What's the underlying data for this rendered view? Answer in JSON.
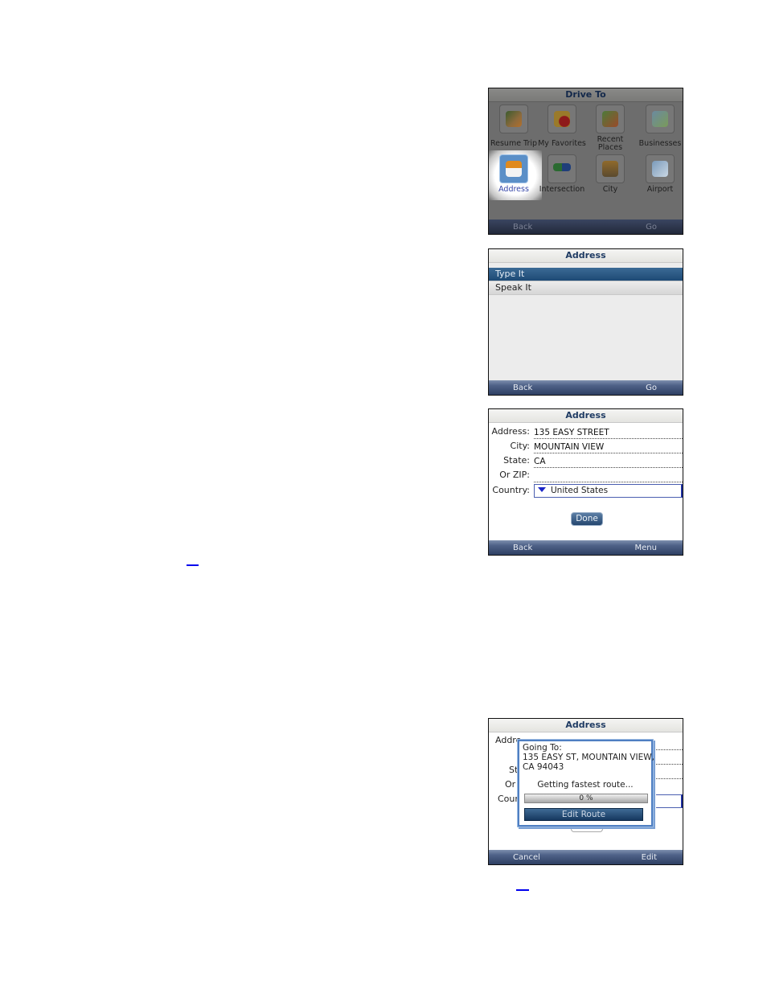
{
  "screens": {
    "drive_to": {
      "title": "Drive To",
      "items": [
        {
          "label": "Resume Trip",
          "icon": "resume-trip-icon"
        },
        {
          "label": "My Favorites",
          "icon": "favorites-folder-icon"
        },
        {
          "label": "Recent Places",
          "icon": "recent-places-icon"
        },
        {
          "label": "Businesses",
          "icon": "businesses-icon"
        },
        {
          "label": "Address",
          "icon": "house-icon",
          "selected": true
        },
        {
          "label": "Intersection",
          "icon": "intersection-sign-icon"
        },
        {
          "label": "City",
          "icon": "city-building-icon"
        },
        {
          "label": "Airport",
          "icon": "airplane-icon"
        }
      ],
      "softkeys": {
        "left": "Back",
        "right": "Go"
      }
    },
    "address_menu": {
      "title": "Address",
      "options": [
        {
          "label": "Type It",
          "selected": true
        },
        {
          "label": "Speak It",
          "selected": false
        }
      ],
      "softkeys": {
        "left": "Back",
        "right": "Go"
      }
    },
    "address_form": {
      "title": "Address",
      "fields": {
        "address": {
          "label": "Address:",
          "value": "135 EASY STREET"
        },
        "city": {
          "label": "City:",
          "value": "MOUNTAIN VIEW"
        },
        "state": {
          "label": "State:",
          "value": "CA"
        },
        "zip": {
          "label": "Or ZIP:",
          "value": ""
        },
        "country": {
          "label": "Country:",
          "value": "United States"
        }
      },
      "done_label": "Done",
      "softkeys": {
        "left": "Back",
        "right": "Menu"
      }
    },
    "routing": {
      "title": "Address",
      "background_fragments": [
        "Addre",
        "St",
        "Or",
        "Cour"
      ],
      "dialog": {
        "going_to_label": "Going To:",
        "address_line1": "135 EASY ST, MOUNTAIN VIEW,",
        "address_line2": "CA 94043",
        "status": "Getting fastest route...",
        "progress_percent": 0,
        "progress_text": "0 %",
        "edit_route_label": "Edit Route"
      },
      "softkeys": {
        "left": "Cancel",
        "right": "Edit"
      }
    }
  },
  "colors": {
    "title_text": "#1f3b63",
    "softkey_bar": "#2e3f63",
    "selection": "#1e4a75",
    "link": "#0000ee"
  }
}
